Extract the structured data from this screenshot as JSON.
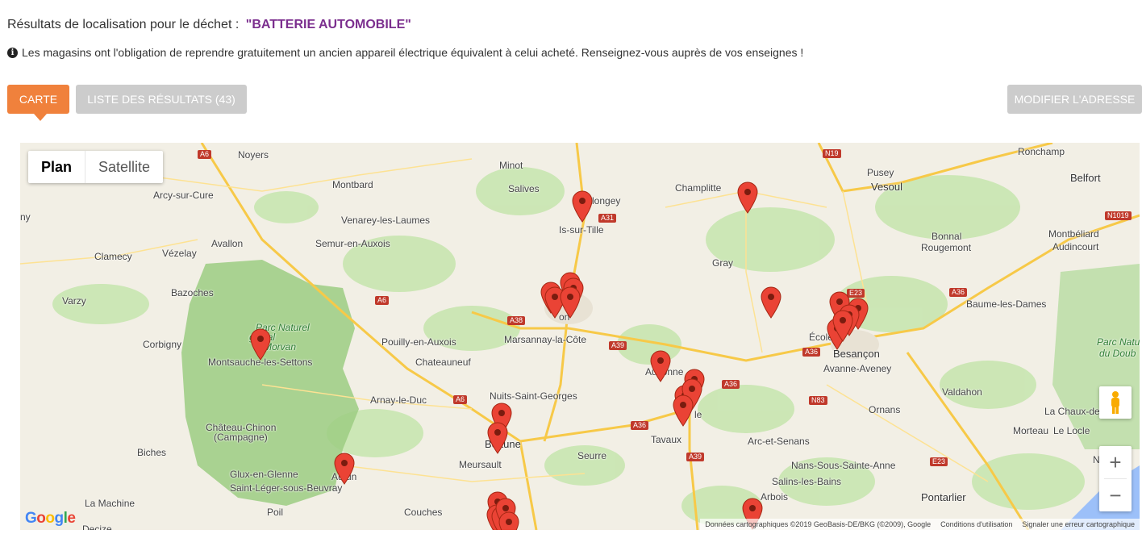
{
  "header": {
    "title_prefix": "Résultats de localisation pour le déchet :",
    "waste_name": "\"BATTERIE AUTOMOBILE\"",
    "info": "Les magasins ont l'obligation de reprendre gratuitement un ancien appareil électrique équivalent à celui acheté. Renseignez-vous auprès de vos enseignes !"
  },
  "tabs": {
    "map": "CARTE",
    "list": "LISTE DES RÉSULTATS (43)",
    "modify": "MODIFIER L'ADRESSE"
  },
  "map": {
    "type_plan": "Plan",
    "type_satellite": "Satellite",
    "zoom_in": "+",
    "zoom_out": "−",
    "logo": "Google",
    "attribution": "Données cartographiques ©2019 GeoBasis-DE/BKG (©2009), Google",
    "terms": "Conditions d'utilisation",
    "report": "Signaler une erreur cartographique",
    "colors": {
      "marker": "#ea4335",
      "forest": "#c8e6b0",
      "park": "#9ccc82",
      "road": "#f7c948",
      "water": "#9cc0f9"
    },
    "places": {
      "noyers": "Noyers",
      "minot": "Minot",
      "champlitte": "Champlitte",
      "pusey": "Pusey",
      "ronchamp": "Ronchamp",
      "belfort": "Belfort",
      "vesoul": "Vesoul",
      "montbard": "Montbard",
      "salives": "Salives",
      "arcy": "Arcy-sur-Cure",
      "longey": "longey",
      "venarey": "Venarey-les-Laumes",
      "istille": "Is-sur-Tille",
      "ny": "ny",
      "bonnal": "Bonnal",
      "rougemont": "Rougemont",
      "montbeliard": "Montbéliard",
      "audincourt": "Audincourt",
      "avallon": "Avallon",
      "semur": "Semur-en-Auxois",
      "clamecy": "Clamecy",
      "vezelay": "Vézelay",
      "gray": "Gray",
      "bazoches": "Bazoches",
      "varzy": "Varzy",
      "baume": "Baume-les-Dames",
      "parc1": "Parc Naturel",
      "parc2": "gional",
      "parc3": "Morvan",
      "pouilly": "Pouilly-en-Auxois",
      "marsannay": "Marsannay-la-Côte",
      "corbigny": "Corbigny",
      "montsauche": "Montsauche-les-Settons",
      "ecole": "École",
      "besancon": "Besançon",
      "parcdoubs1": "Parc Natu",
      "parcdoubs2": "du Doub",
      "chateauneuf": "Chateauneuf",
      "auxonne": "Auxonne",
      "avanne": "Avanne-Aveney",
      "arnay": "Arnay-le-Duc",
      "nuits": "Nuits-Saint-Georges",
      "valdahon": "Valdahon",
      "chateauchinon1": "Château-Chinon",
      "chateauchinon2": "(Campagne)",
      "ornans": "Ornans",
      "chauxde": "La Chaux-de",
      "beaune": "Beaune",
      "tavaux": "Tavaux",
      "arc": "Arc-et-Senans",
      "morteau": "Morteau",
      "locle": "Le Locle",
      "biches": "Biches",
      "meursault": "Meursault",
      "seurre": "Seurre",
      "autun": "Autun",
      "nans": "Nans-Sous-Sainte-Anne",
      "glux": "Glux-en-Glenne",
      "salins": "Salins-les-Bains",
      "stleger": "Saint-Léger-sous-Beuvray",
      "pontarlier": "Pontarlier",
      "arbois": "Arbois",
      "lamachine": "La Machine",
      "poil": "Poil",
      "couches": "Couches",
      "decize": "Decize",
      "ne": "Ne",
      "dole": "le",
      "dijon": "on"
    },
    "roads": {
      "a6a": "A6",
      "n19": "N19",
      "a31": "A31",
      "n1019": "N1019",
      "a6b": "A6",
      "e23a": "E23",
      "a36a": "A36",
      "a38": "A38",
      "a39a": "A39",
      "a36b": "A36",
      "a36c": "A36",
      "a6c": "A6",
      "n83": "N83",
      "a36d": "A36",
      "a39b": "A39",
      "e23b": "E23"
    }
  }
}
